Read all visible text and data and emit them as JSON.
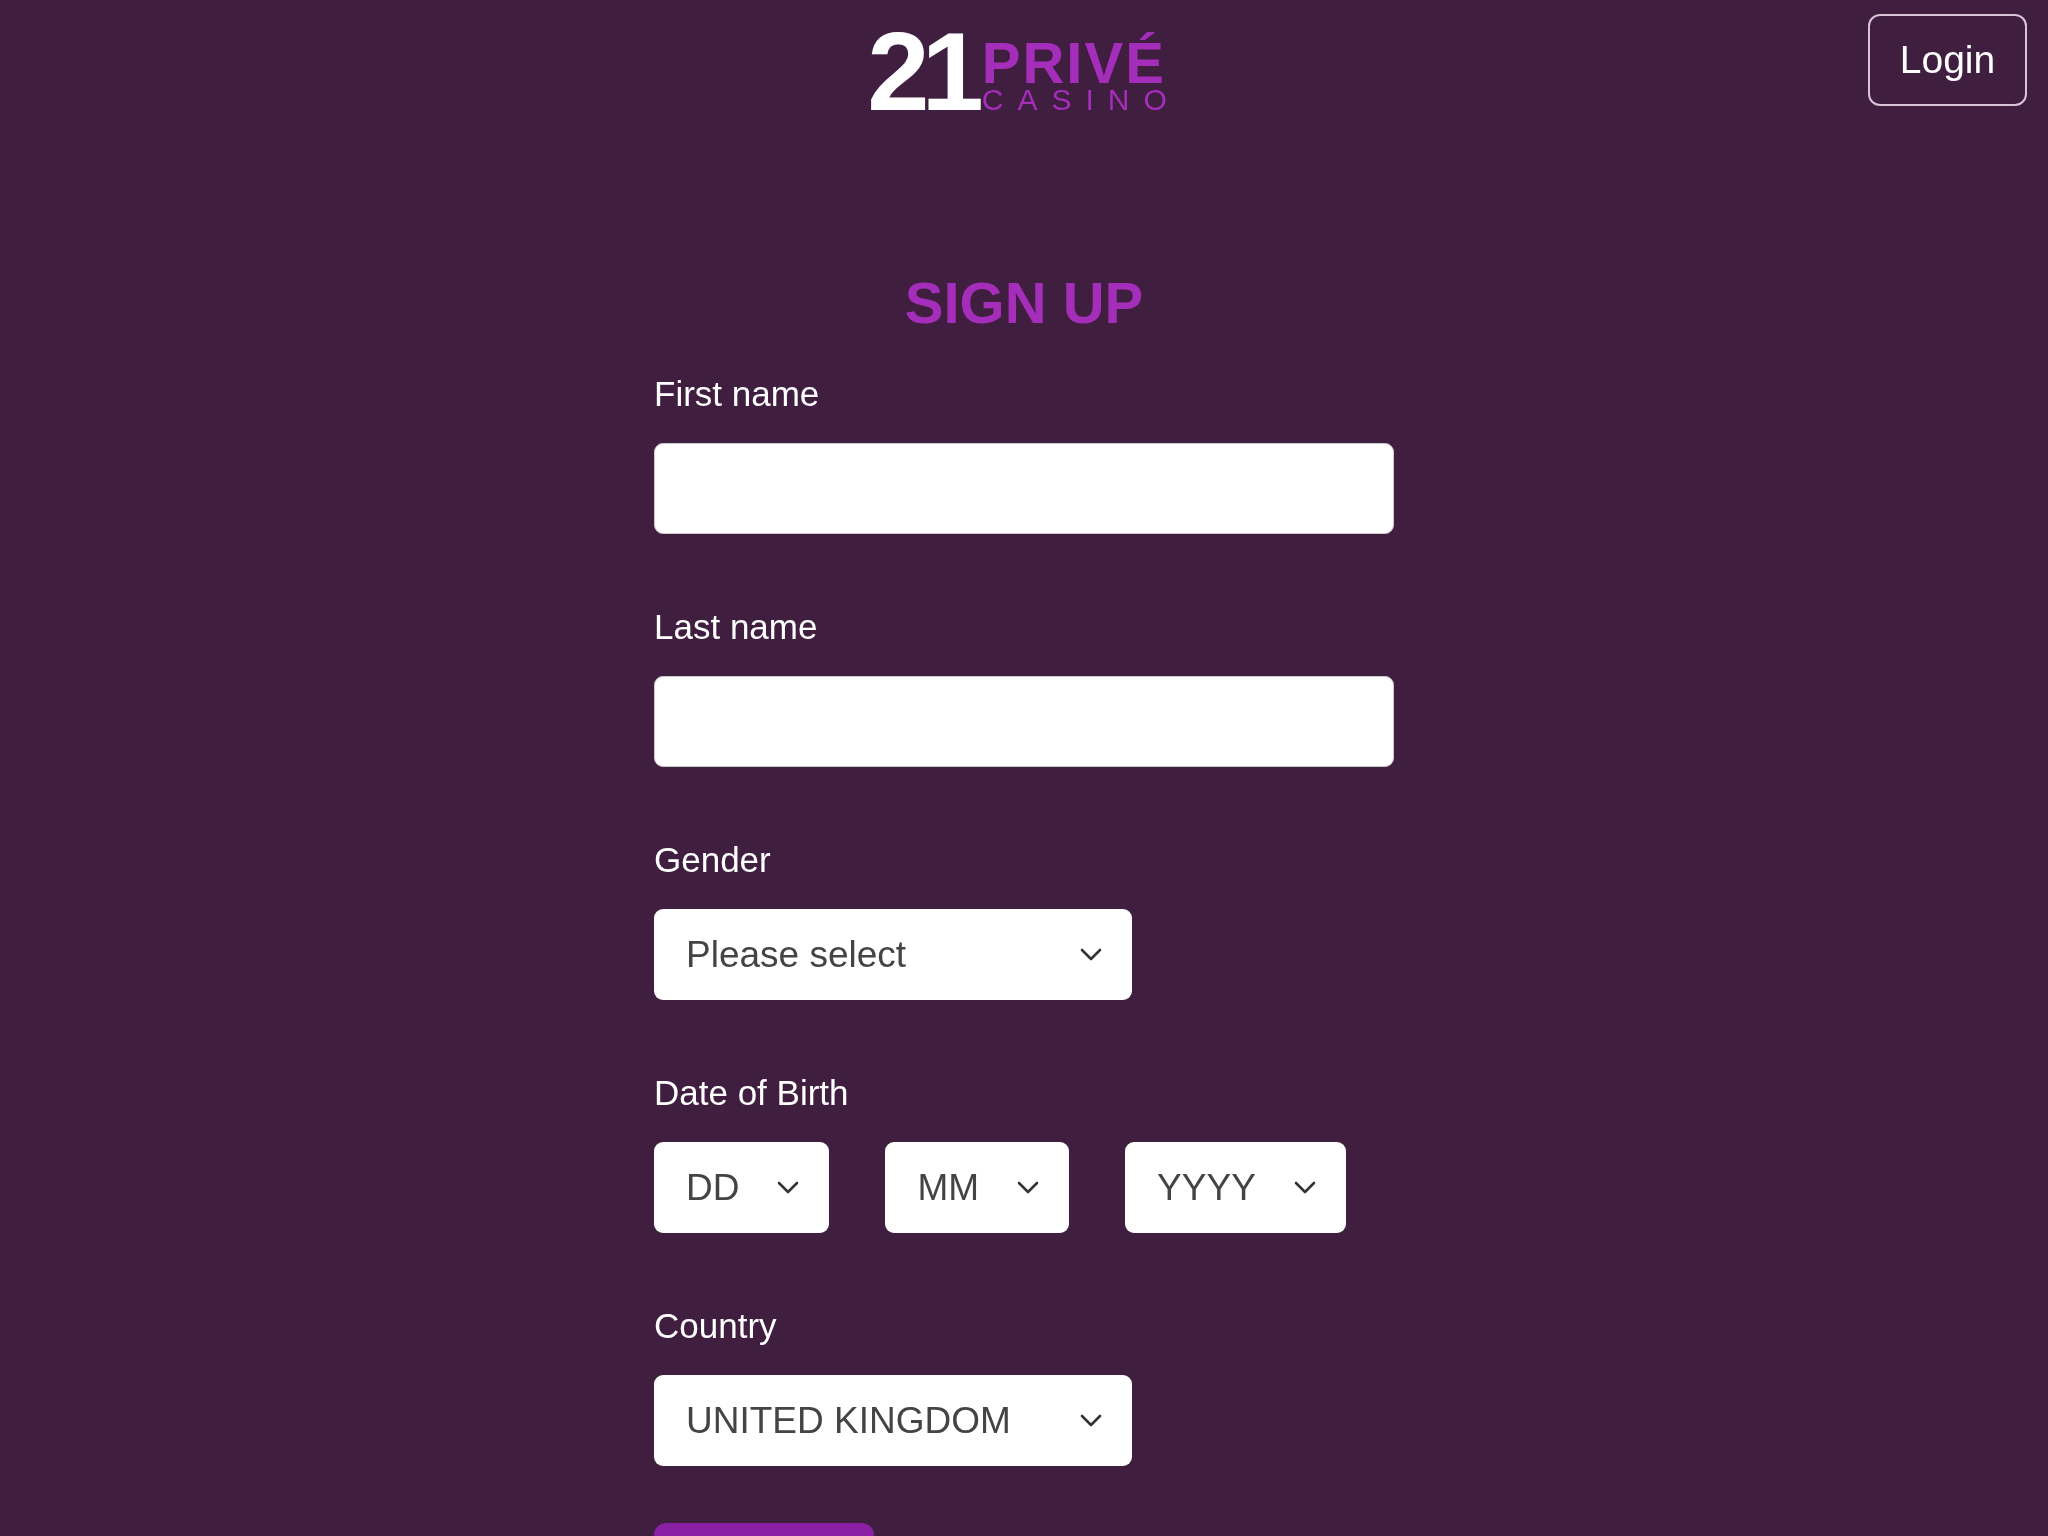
{
  "logo": {
    "number": "21",
    "name": "PRIVÉ",
    "subtitle": "CASINO"
  },
  "header": {
    "login_button": "Login"
  },
  "title": "SIGN UP",
  "fields": [
    {
      "kind": "text",
      "label": "First name"
    },
    {
      "kind": "text",
      "label": "Last name"
    },
    {
      "kind": "select",
      "label": "Gender",
      "selects": [
        "Please select"
      ]
    },
    {
      "kind": "select-row",
      "label": "Date of Birth",
      "selects": [
        "DD",
        "MM",
        "YYYY"
      ]
    },
    {
      "kind": "select",
      "label": "Country",
      "selects": [
        "UNITED KINGDOM"
      ]
    }
  ]
}
